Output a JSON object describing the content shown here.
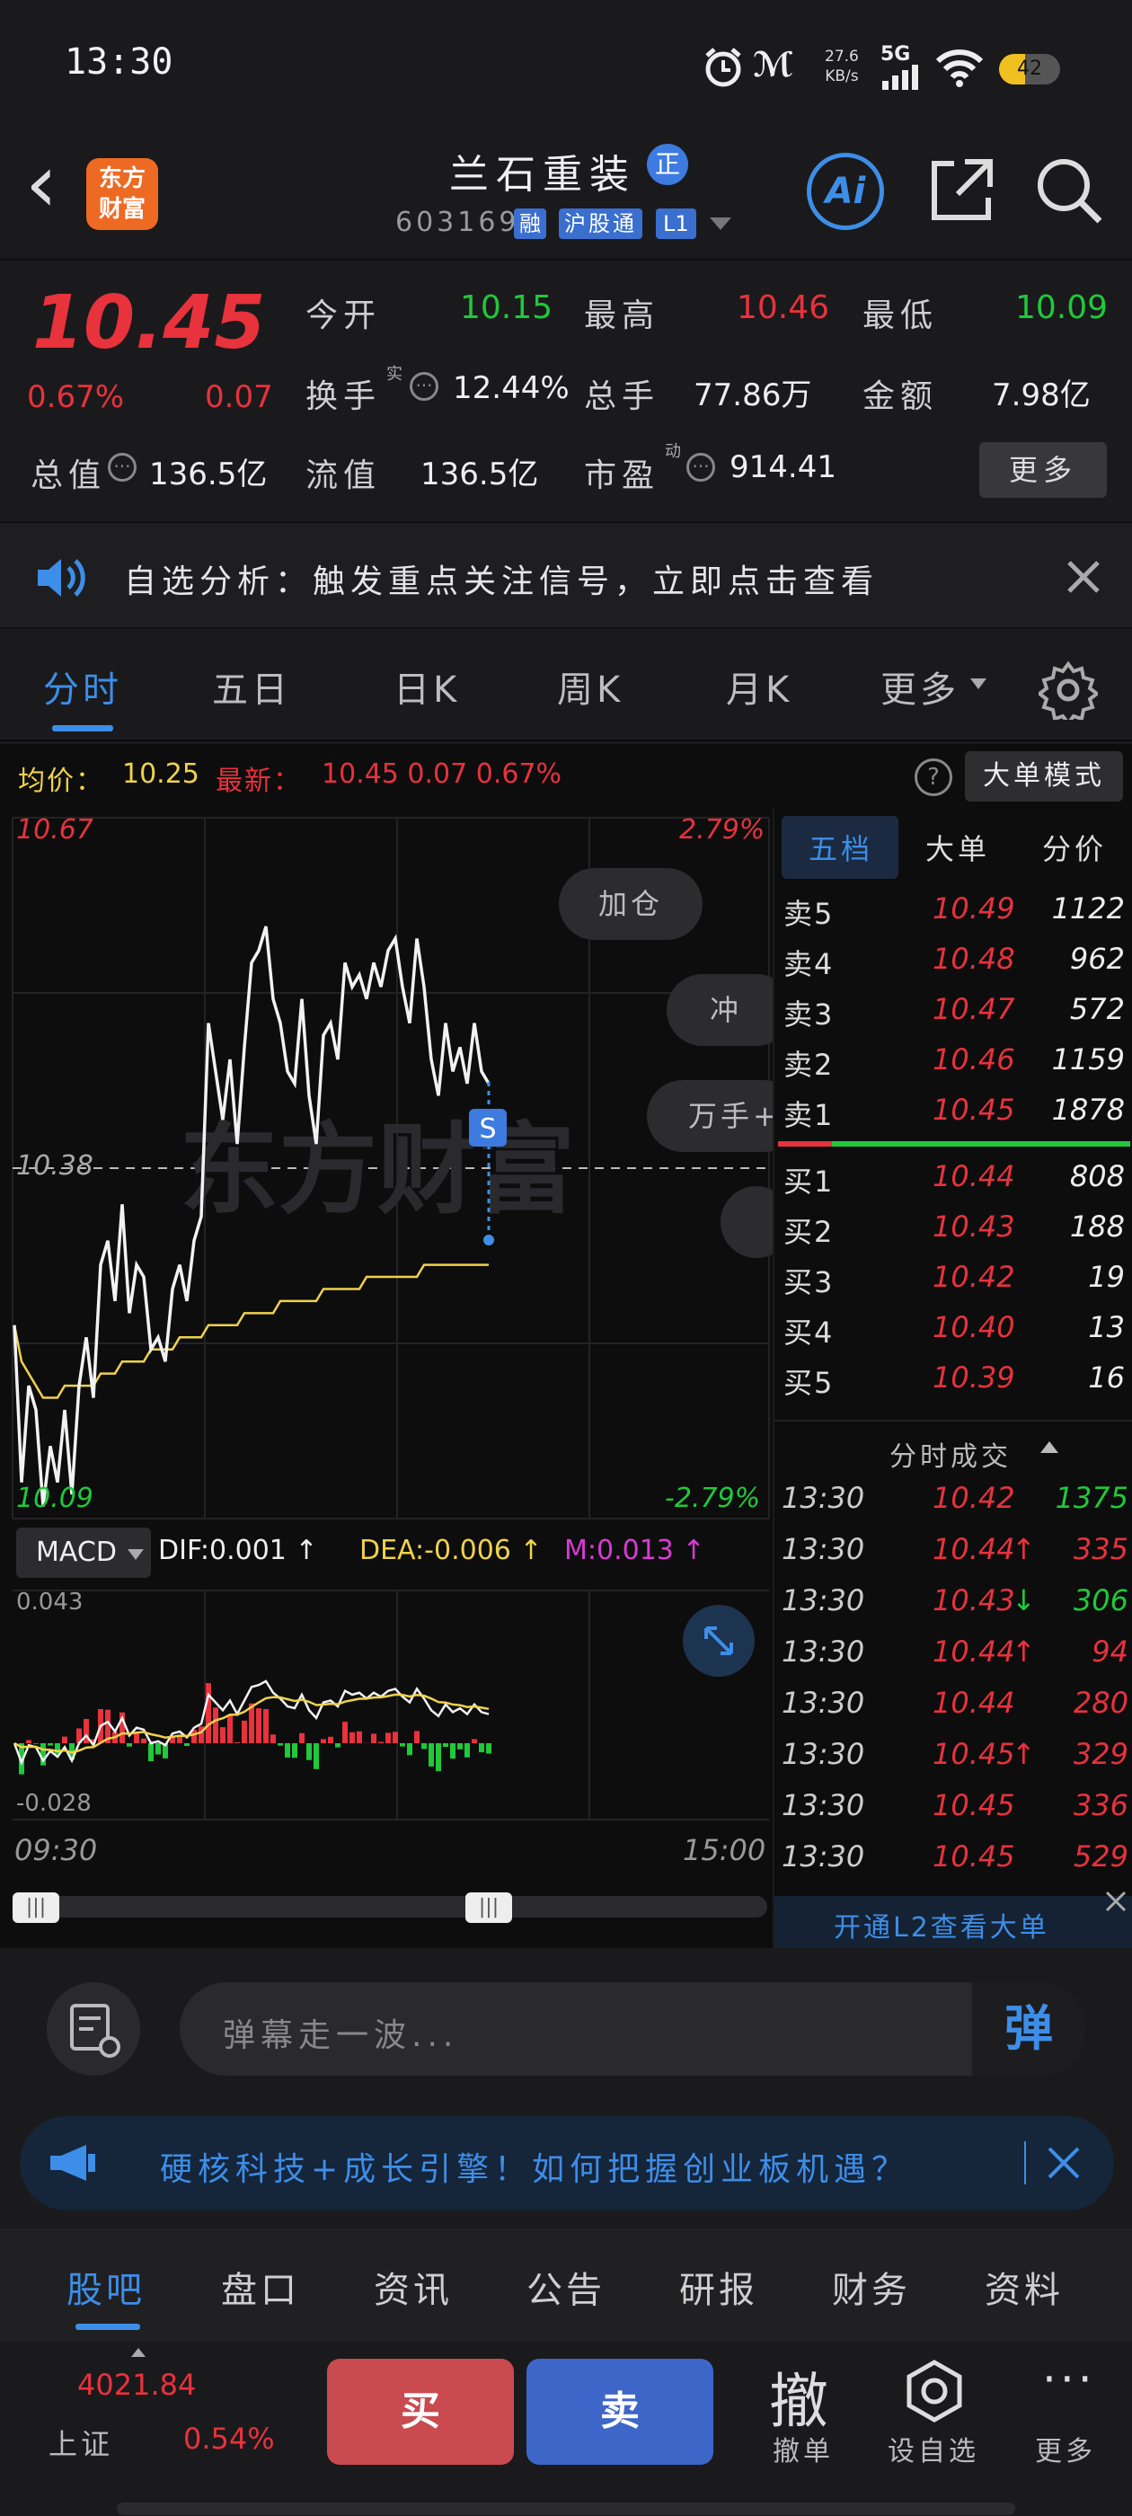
{
  "status": {
    "time": "13:30",
    "net_speed": "27.6",
    "net_unit": "KB/s",
    "net_type": "5G",
    "battery": "42"
  },
  "header": {
    "back": "‹",
    "logo_line1": "东方",
    "logo_line2": "财富",
    "stock_name": "兰石重装",
    "badge_zheng": "正",
    "stock_code": "603169",
    "tag_rong": "融",
    "tag_hgt": "沪股通",
    "tag_l1": "L1",
    "ai": "Ai"
  },
  "quote": {
    "price": "10.45",
    "change_pct": "0.67%",
    "change": "0.07",
    "open_label": "今开",
    "open": "10.15",
    "high_label": "最高",
    "high": "10.46",
    "low_label": "最低",
    "low": "10.09",
    "turnover_label": "换手",
    "turnover_sup": "实",
    "turnover": "12.44%",
    "volume_label": "总手",
    "volume": "77.86万",
    "amount_label": "金额",
    "amount": "7.98亿",
    "mktcap_label": "总值",
    "mktcap": "136.5亿",
    "float_label": "流值",
    "float": "136.5亿",
    "pe_label": "市盈",
    "pe_sup": "动",
    "pe": "914.41",
    "more": "更多"
  },
  "banner": {
    "text": "自选分析：触发重点关注信号，立即点击查看"
  },
  "tabs": [
    "分时",
    "五日",
    "日K",
    "周K",
    "月K",
    "更多"
  ],
  "infobar": {
    "avg_label": "均价：",
    "avg": "10.25",
    "latest_label": "最新：",
    "latest": "10.45 0.07 0.67%",
    "mode": "大单模式"
  },
  "chart": {
    "top_price": "10.67",
    "top_pct": "2.79%",
    "mid_price": "10.38",
    "bottom_price": "10.09",
    "bottom_pct": "-2.79%",
    "btn_jiacang": "加仓",
    "btn_chong": "冲",
    "btn_wanshou": "万手+",
    "marker": "S",
    "watermark": "东方财富",
    "macd_label": "MACD",
    "dif": "DIF:0.001 ↑",
    "dea": "DEA:-0.006 ↑",
    "m": "M:0.013 ↑",
    "macd_top": "0.043",
    "macd_bottom": "-0.028",
    "time_start": "09:30",
    "time_end": "15:00"
  },
  "chart_data": {
    "type": "line",
    "title": "",
    "ylim": [
      10.09,
      10.67
    ],
    "reference_price": 10.38,
    "x_range": [
      "09:30",
      "15:00"
    ],
    "series": [
      {
        "name": "最新",
        "values": [
          10.25,
          10.12,
          10.2,
          10.18,
          10.1,
          10.15,
          10.12,
          10.18,
          10.11,
          10.2,
          10.24,
          10.19,
          10.3,
          10.32,
          10.27,
          10.35,
          10.26,
          10.3,
          10.29,
          10.23,
          10.24,
          10.22,
          10.28,
          10.3,
          10.27,
          10.32,
          10.34,
          10.5,
          10.46,
          10.42,
          10.47,
          10.4,
          10.48,
          10.55,
          10.56,
          10.58,
          10.52,
          10.5,
          10.46,
          10.45,
          10.52,
          10.44,
          10.4,
          10.49,
          10.5,
          10.47,
          10.55,
          10.53,
          10.54,
          10.52,
          10.55,
          10.53,
          10.56,
          10.57,
          10.53,
          10.5,
          10.57,
          10.53,
          10.47,
          10.44,
          10.5,
          10.46,
          10.48,
          10.45,
          10.5,
          10.46,
          10.45
        ]
      },
      {
        "name": "均价",
        "values": [
          10.25,
          10.22,
          10.21,
          10.2,
          10.19,
          10.19,
          10.19,
          10.2,
          10.2,
          10.2,
          10.2,
          10.2,
          10.21,
          10.21,
          10.21,
          10.22,
          10.22,
          10.22,
          10.22,
          10.23,
          10.23,
          10.23,
          10.23,
          10.24,
          10.24,
          10.24,
          10.24,
          10.25,
          10.25,
          10.25,
          10.25,
          10.25,
          10.26,
          10.26,
          10.26,
          10.26,
          10.26,
          10.27,
          10.27,
          10.27,
          10.27,
          10.27,
          10.27,
          10.28,
          10.28,
          10.28,
          10.28,
          10.28,
          10.28,
          10.29,
          10.29,
          10.29,
          10.29,
          10.29,
          10.29,
          10.29,
          10.29,
          10.3,
          10.3,
          10.3,
          10.3,
          10.3,
          10.3,
          10.3,
          10.3,
          10.3,
          10.3
        ]
      }
    ]
  },
  "orderbook": {
    "tabs": [
      "五档",
      "大单",
      "分价"
    ],
    "asks": [
      {
        "label": "卖5",
        "price": "10.49",
        "vol": "1122"
      },
      {
        "label": "卖4",
        "price": "10.48",
        "vol": "962"
      },
      {
        "label": "卖3",
        "price": "10.47",
        "vol": "572"
      },
      {
        "label": "卖2",
        "price": "10.46",
        "vol": "1159"
      },
      {
        "label": "卖1",
        "price": "10.45",
        "vol": "1878"
      }
    ],
    "bids": [
      {
        "label": "买1",
        "price": "10.44",
        "vol": "808"
      },
      {
        "label": "买2",
        "price": "10.43",
        "vol": "188"
      },
      {
        "label": "买3",
        "price": "10.42",
        "vol": "19"
      },
      {
        "label": "买4",
        "price": "10.40",
        "vol": "13"
      },
      {
        "label": "买5",
        "price": "10.39",
        "vol": "16"
      }
    ],
    "ticks_title": "分时成交",
    "ticks": [
      {
        "time": "13:30",
        "price": "10.42",
        "arrow": "",
        "vol": "1375",
        "color": "green"
      },
      {
        "time": "13:30",
        "price": "10.44",
        "arrow": "↑",
        "vol": "335",
        "color": "red"
      },
      {
        "time": "13:30",
        "price": "10.43",
        "arrow": "↓",
        "vol": "306",
        "color": "green"
      },
      {
        "time": "13:30",
        "price": "10.44",
        "arrow": "↑",
        "vol": "94",
        "color": "red"
      },
      {
        "time": "13:30",
        "price": "10.44",
        "arrow": "",
        "vol": "280",
        "color": "red"
      },
      {
        "time": "13:30",
        "price": "10.45",
        "arrow": "↑",
        "vol": "329",
        "color": "red"
      },
      {
        "time": "13:30",
        "price": "10.45",
        "arrow": "",
        "vol": "336",
        "color": "red"
      },
      {
        "time": "13:30",
        "price": "10.45",
        "arrow": "",
        "vol": "529",
        "color": "red"
      }
    ],
    "l2_link": "开通L2查看大单"
  },
  "danmu": {
    "placeholder": "弹幕走一波...",
    "btn": "弹"
  },
  "ad": {
    "text": "硬核科技+成长引擎！如何把握创业板机遇？"
  },
  "bottom_tabs": [
    "股吧",
    "盘口",
    "资讯",
    "公告",
    "研报",
    "财务",
    "资料"
  ],
  "trade": {
    "index_value": "4021.84",
    "index_name": "上证",
    "index_pct": "0.54%",
    "buy": "买",
    "sell": "卖",
    "cancel_icon": "撤",
    "cancel": "撤单",
    "watchlist": "设自选",
    "more": "更多"
  },
  "colors": {
    "up": "#e8323c",
    "down": "#1fc93a",
    "accent": "#3d8ee8",
    "avg_line": "#f0d24a",
    "buy_btn": "#c94a4f",
    "sell_btn": "#3e66c8"
  }
}
